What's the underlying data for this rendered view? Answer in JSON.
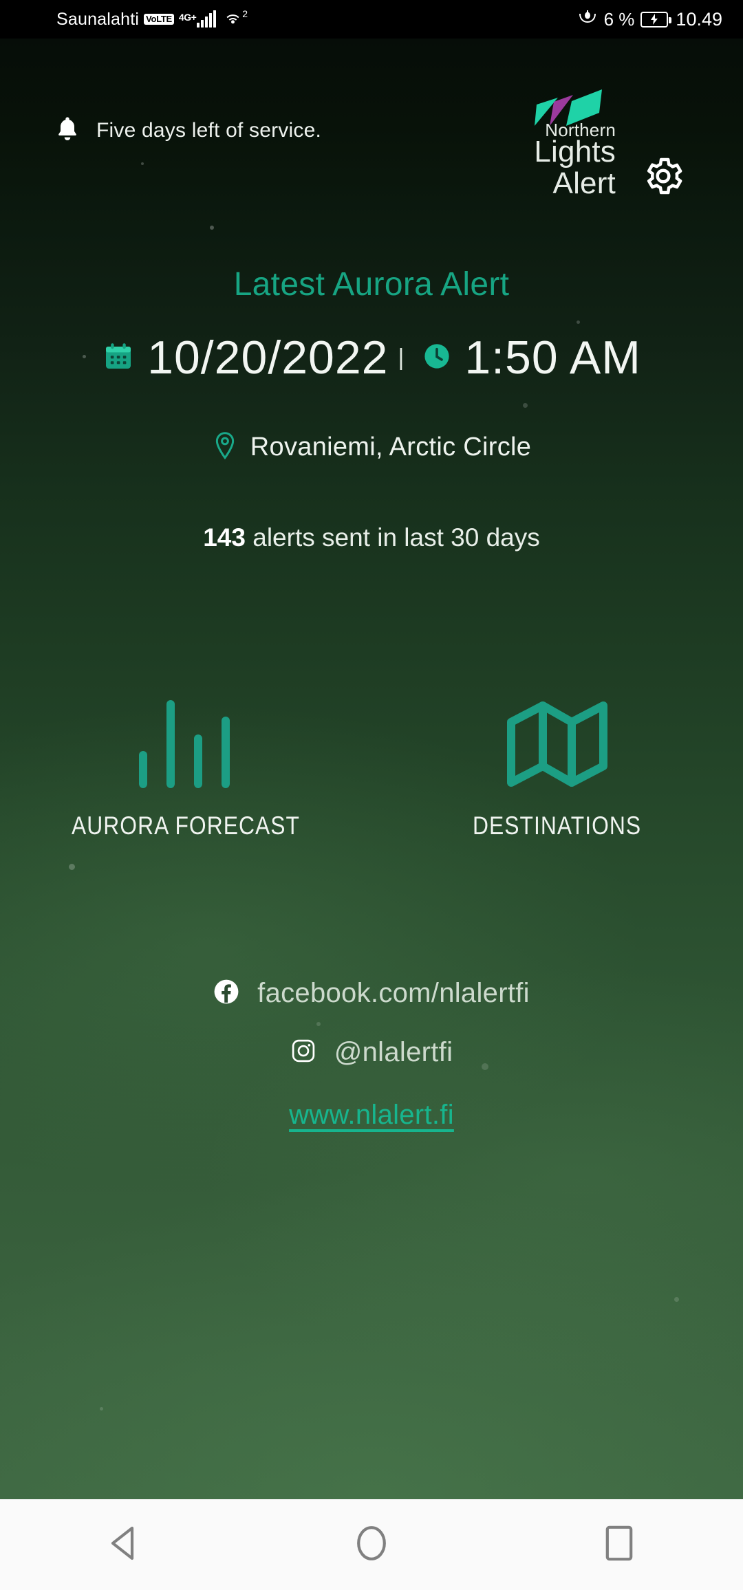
{
  "statusbar": {
    "carrier": "Saunalahti",
    "volte_badge": "VoLTE",
    "network_type": "4G+",
    "wifi_superscript": "2",
    "battery_percent": "6 %",
    "clock": "10.49",
    "icons": [
      "volte-badge",
      "signal-bars-icon",
      "wifi-icon",
      "eye-icon",
      "battery-charging-icon"
    ]
  },
  "header": {
    "notice": "Five days left of service.",
    "notice_icon": "bell-icon",
    "settings_icon": "gear-icon",
    "logo": {
      "line1": "Northern",
      "line2": "Lights",
      "line3": "Alert",
      "beam_colors": [
        "#1fd2a7",
        "#9b3a9d",
        "#1fd2a7"
      ]
    }
  },
  "alert": {
    "title": "Latest Aurora Alert",
    "date": "10/20/2022",
    "separator": "|",
    "time": "1:50 AM",
    "date_icon": "calendar-icon",
    "time_icon": "clock-icon",
    "location": "Rovaniemi, Arctic Circle",
    "location_icon": "map-pin-icon",
    "count": "143",
    "count_suffix": " alerts sent in last 30 days"
  },
  "actions": [
    {
      "label": "AURORA FORECAST",
      "icon": "bar-chart-icon"
    },
    {
      "label": "DESTINATIONS",
      "icon": "map-icon"
    }
  ],
  "social": {
    "facebook": {
      "icon": "facebook-icon",
      "text": "facebook.com/nlalertfi"
    },
    "instagram": {
      "icon": "instagram-icon",
      "text": "@nlalertfi"
    },
    "website": "www.nlalert.fi"
  },
  "navbar": {
    "back": "back-button",
    "home": "home-button",
    "recents": "recents-button"
  },
  "colors": {
    "accent_teal": "#17a583",
    "link_teal": "#17b58e",
    "icon_teal": "#1c9e84",
    "bg_top": "#060d08",
    "bg_bottom": "#3e6742",
    "navbar_bg": "#fafafa"
  }
}
